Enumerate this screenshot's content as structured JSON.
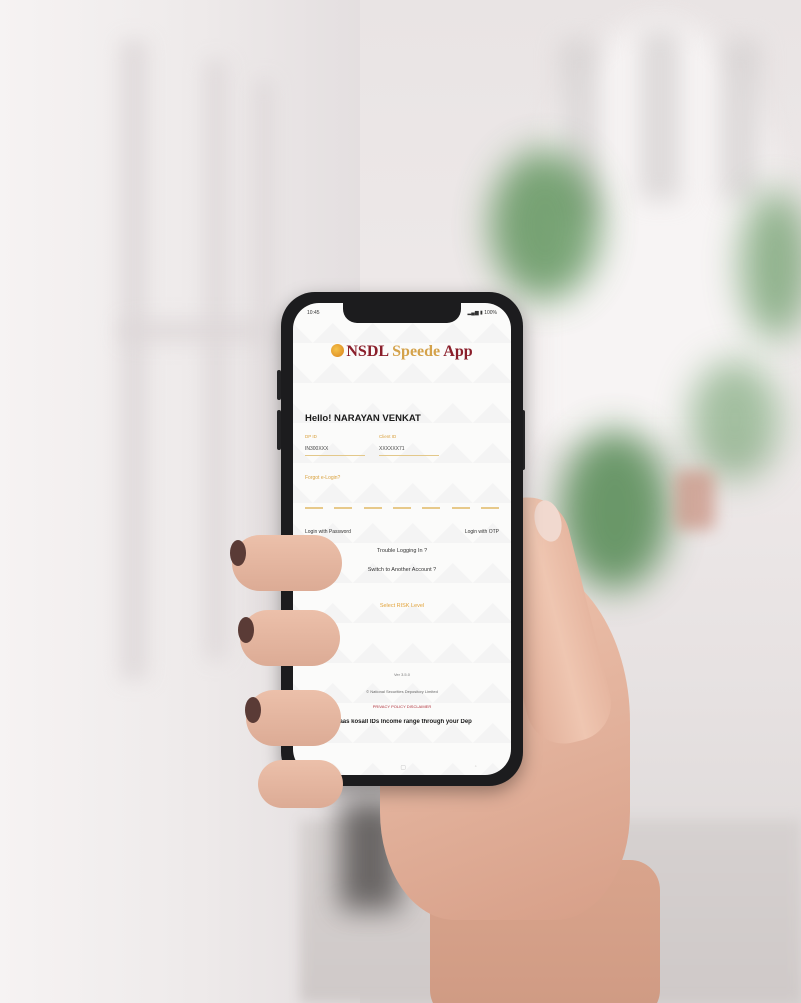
{
  "status_bar": {
    "time": "10:45",
    "icons": "▂▄▆ ▮ 100%"
  },
  "app": {
    "brand_nsdl": "NSDL",
    "brand_speede": "Speede",
    "brand_app": "App"
  },
  "login": {
    "greeting": "Hello! NARAYAN VENKAT",
    "field1_label": "DP ID",
    "field1_value": "IN300XXX",
    "field2_label": "Client ID",
    "field2_value": "XXXXXX71",
    "forgot_link": "Forgot e-Login?",
    "login_with_password": "Login with Password",
    "login_with_otp": "Login with OTP",
    "trouble": "Trouble Logging In ?",
    "switch_account": "Switch to Another Account ?",
    "primary_action": "Select RISK Level"
  },
  "footer": {
    "version": "Ver 3.5.0",
    "copyright": "© National Securities Depository Limited",
    "legal": "PRIVACY POLICY  DISCLAIMER",
    "ticker": "ndaas kosall IDs Income range through your Dep"
  },
  "nav": {
    "back": "◁",
    "home": "▢",
    "recent": "◦"
  }
}
